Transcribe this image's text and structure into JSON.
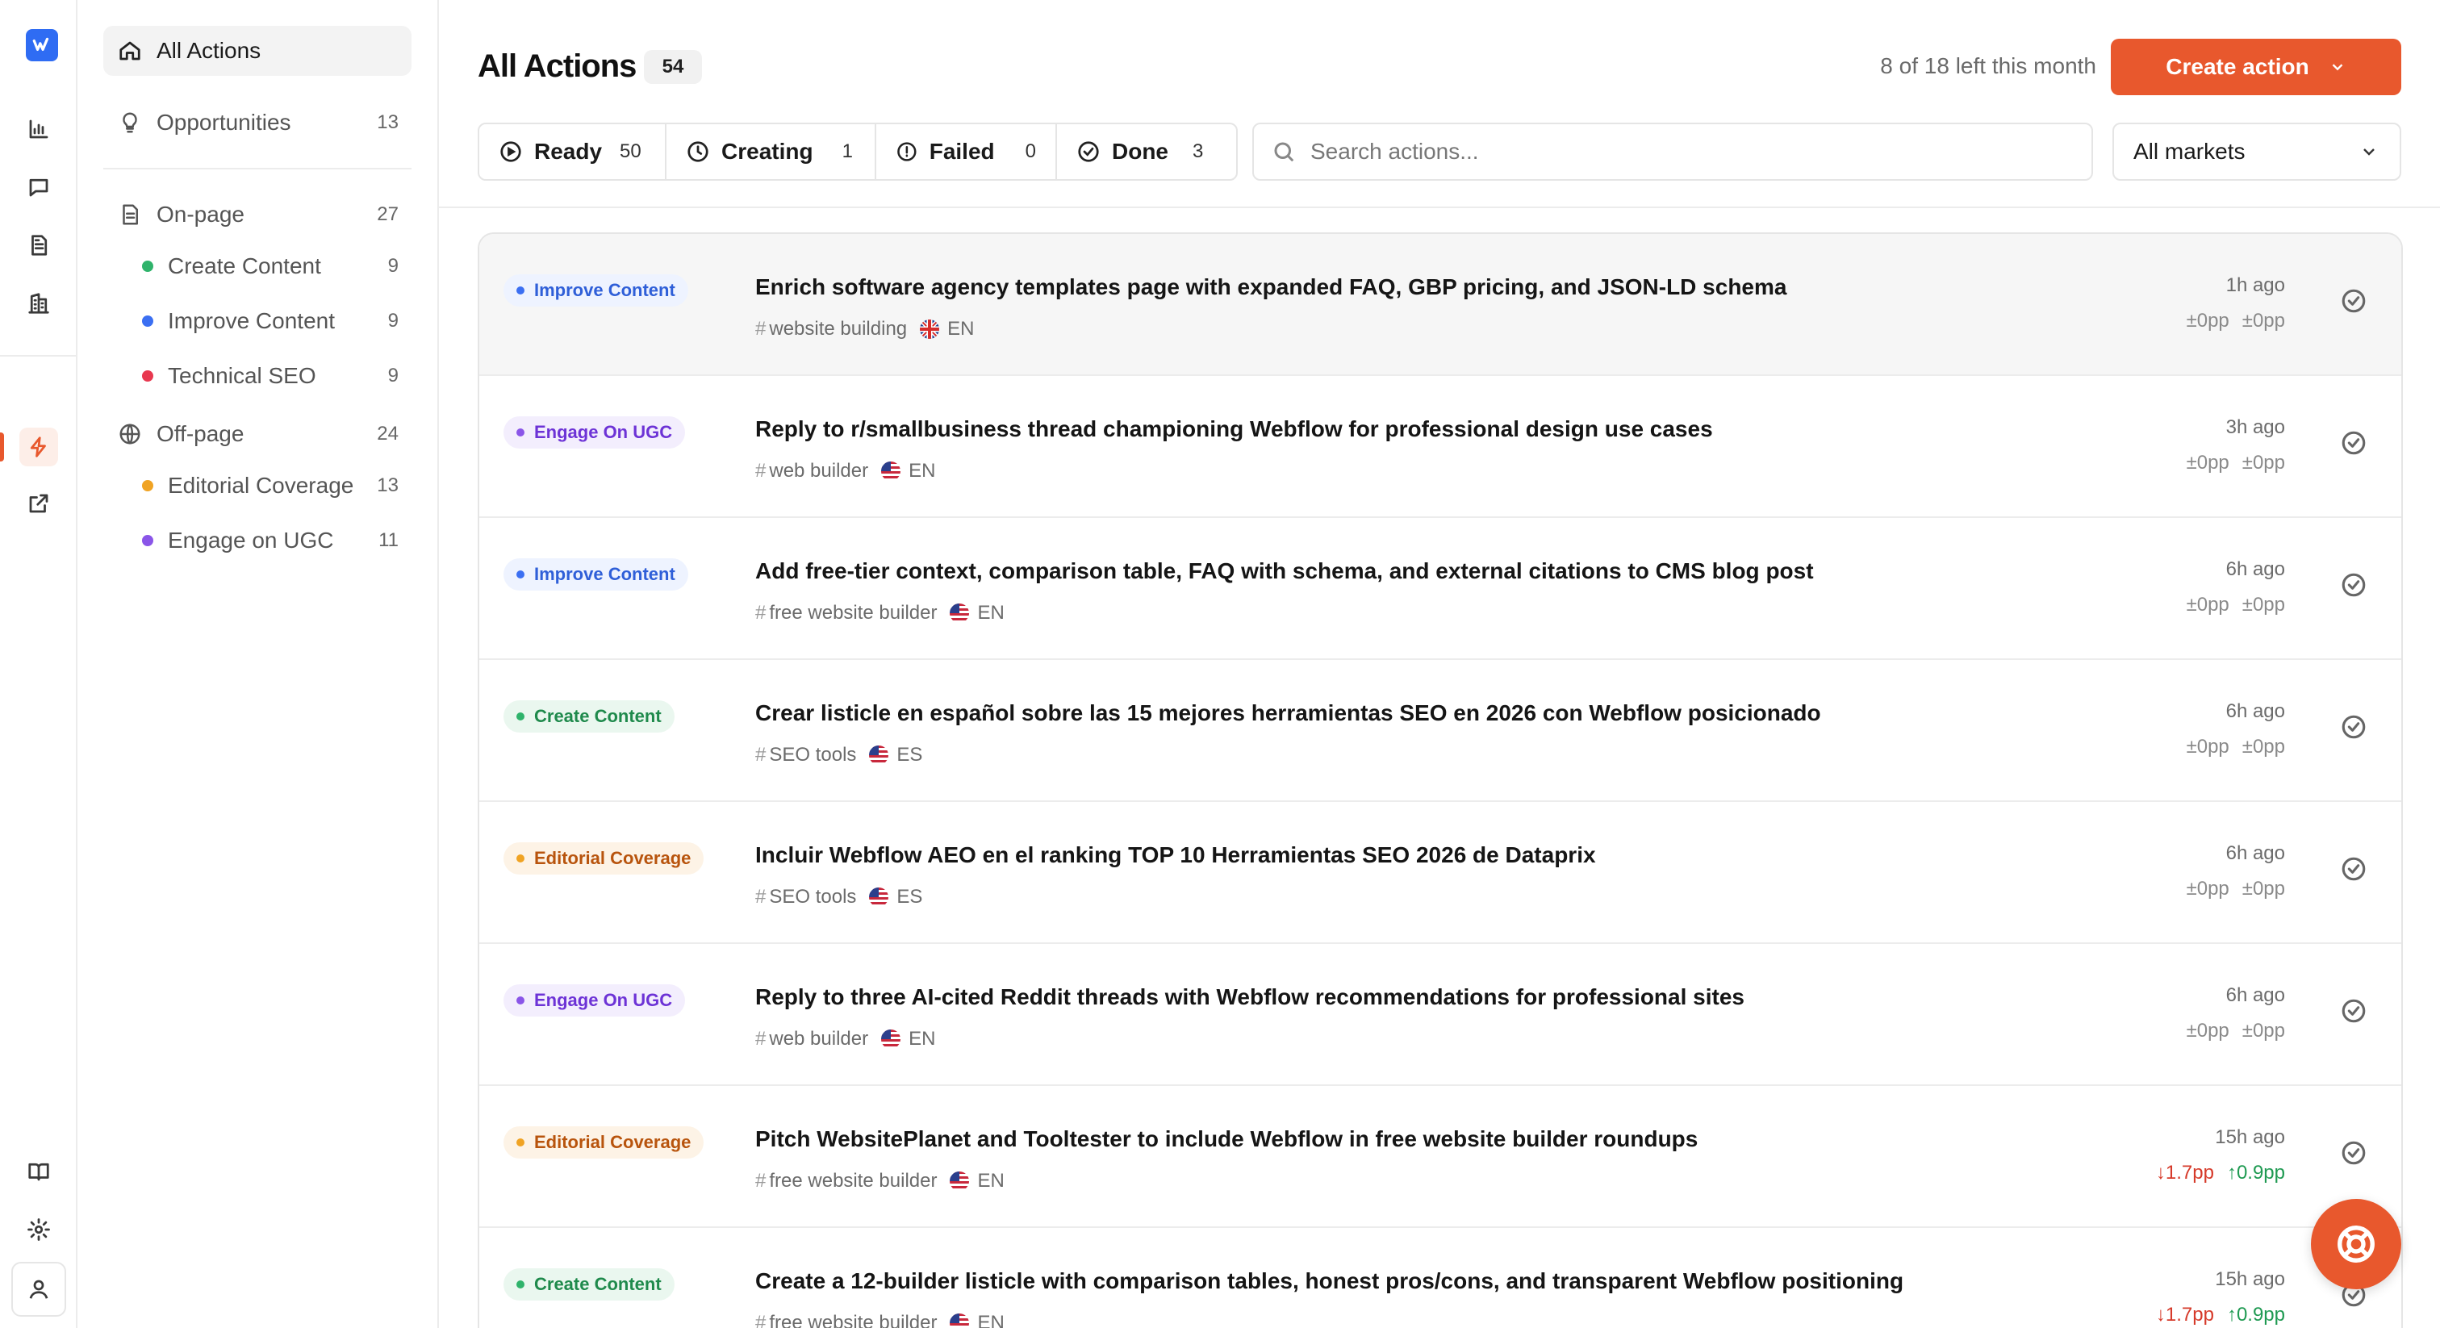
{
  "sidebar": {
    "all_actions": "All Actions",
    "opportunities": {
      "label": "Opportunities",
      "count": "13"
    },
    "on_page": {
      "label": "On-page",
      "count": "27"
    },
    "on_page_items": [
      {
        "label": "Create Content",
        "count": "9",
        "color": "#2fb36b"
      },
      {
        "label": "Improve Content",
        "count": "9",
        "color": "#3b6ff2"
      },
      {
        "label": "Technical SEO",
        "count": "9",
        "color": "#e8384f"
      }
    ],
    "off_page": {
      "label": "Off-page",
      "count": "24"
    },
    "off_page_items": [
      {
        "label": "Editorial Coverage",
        "count": "13",
        "color": "#f0a323"
      },
      {
        "label": "Engage on UGC",
        "count": "11",
        "color": "#8a55e8"
      }
    ]
  },
  "header": {
    "title": "All Actions",
    "count": "54",
    "quota": "8 of 18 left this month",
    "create_label": "Create action"
  },
  "filters": [
    {
      "label": "Ready",
      "count": "50",
      "icon": "play-circle-icon"
    },
    {
      "label": "Creating",
      "count": "1",
      "icon": "clock-icon"
    },
    {
      "label": "Failed",
      "count": "0",
      "icon": "alert-circle-icon"
    },
    {
      "label": "Done",
      "count": "3",
      "icon": "check-circle-icon"
    }
  ],
  "search": {
    "placeholder": "Search actions..."
  },
  "market": {
    "value": "All markets"
  },
  "colors": {
    "accent": "#e8582d"
  },
  "actions": [
    {
      "tag": "Improve Content",
      "title": "Enrich software agency templates page with expanded FAQ, GBP pricing, and JSON-LD schema",
      "keyword": "website building",
      "flag": "uk",
      "lang": "EN",
      "time": "1h ago",
      "d1": "±0pp",
      "d2": "±0pp"
    },
    {
      "tag": "Engage On UGC",
      "title": "Reply to r/smallbusiness thread championing Webflow for professional design use cases",
      "keyword": "web builder",
      "flag": "us",
      "lang": "EN",
      "time": "3h ago",
      "d1": "±0pp",
      "d2": "±0pp"
    },
    {
      "tag": "Improve Content",
      "title": "Add free-tier context, comparison table, FAQ with schema, and external citations to CMS blog post",
      "keyword": "free website builder",
      "flag": "us",
      "lang": "EN",
      "time": "6h ago",
      "d1": "±0pp",
      "d2": "±0pp"
    },
    {
      "tag": "Create Content",
      "title": "Crear listicle en español sobre las 15 mejores herramientas SEO en 2026 con Webflow posicionado",
      "keyword": "SEO tools",
      "flag": "us",
      "lang": "ES",
      "time": "6h ago",
      "d1": "±0pp",
      "d2": "±0pp"
    },
    {
      "tag": "Editorial Coverage",
      "title": "Incluir Webflow AEO en el ranking TOP 10 Herramientas SEO 2026 de Dataprix",
      "keyword": "SEO tools",
      "flag": "us",
      "lang": "ES",
      "time": "6h ago",
      "d1": "±0pp",
      "d2": "±0pp"
    },
    {
      "tag": "Engage On UGC",
      "title": "Reply to three AI-cited Reddit threads with Webflow recommendations for professional sites",
      "keyword": "web builder",
      "flag": "us",
      "lang": "EN",
      "time": "6h ago",
      "d1": "±0pp",
      "d2": "±0pp"
    },
    {
      "tag": "Editorial Coverage",
      "title": "Pitch WebsitePlanet and Tooltester to include Webflow in free website builder roundups",
      "keyword": "free website builder",
      "flag": "us",
      "lang": "EN",
      "time": "15h ago",
      "d1": "↓1.7pp",
      "d2": "↑0.9pp"
    },
    {
      "tag": "Create Content",
      "title": "Create a 12-builder listicle with comparison tables, honest pros/cons, and transparent Webflow positioning",
      "keyword": "free website builder",
      "flag": "us",
      "lang": "EN",
      "time": "15h ago",
      "d1": "↓1.7pp",
      "d2": "↑0.9pp"
    }
  ]
}
